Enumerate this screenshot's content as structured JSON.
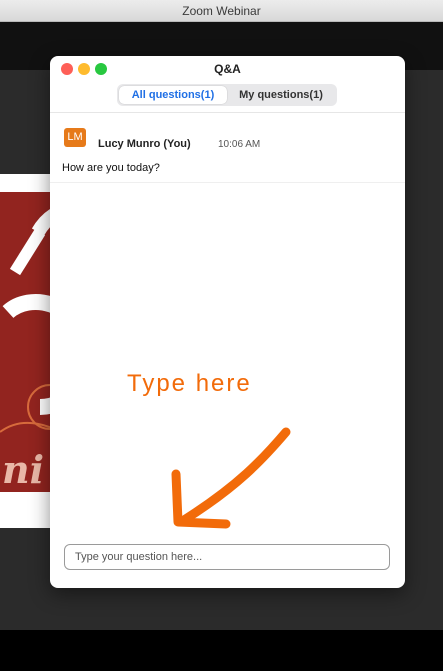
{
  "app": {
    "window_title": "Zoom Webinar"
  },
  "qa": {
    "title": "Q&A",
    "tabs": [
      {
        "label": "All questions(1)",
        "active": true
      },
      {
        "label": "My questions(1)",
        "active": false
      }
    ],
    "questions": [
      {
        "avatar_initials": "LM",
        "avatar_color": "#e67a1a",
        "author": "Lucy Munro (You)",
        "time": "10:06 AM",
        "text": "How are you today?"
      }
    ],
    "input": {
      "placeholder": "Type your question here...",
      "value": ""
    }
  },
  "annotation": {
    "text": "Type here",
    "color": "#f26b0a"
  },
  "shared_slide": {
    "visible_text": "ni"
  },
  "colors": {
    "accent": "#1f6fe5",
    "slide_red": "#92241f"
  },
  "icons": [
    "close-icon",
    "minimize-icon",
    "maximize-icon",
    "arrow-icon"
  ]
}
